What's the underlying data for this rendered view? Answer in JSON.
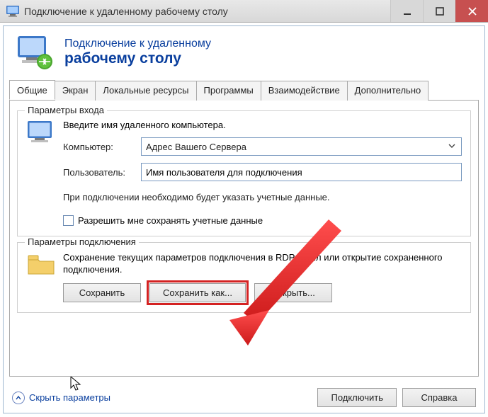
{
  "window": {
    "title": "Подключение к удаленному рабочему столу"
  },
  "header": {
    "subtitle": "Подключение к удаленному",
    "title": "рабочему столу"
  },
  "tabs": [
    {
      "label": "Общие"
    },
    {
      "label": "Экран"
    },
    {
      "label": "Локальные ресурсы"
    },
    {
      "label": "Программы"
    },
    {
      "label": "Взаимодействие"
    },
    {
      "label": "Дополнительно"
    }
  ],
  "login_group": {
    "legend": "Параметры входа",
    "intro": "Введите имя удаленного компьютера.",
    "computer_label": "Компьютер:",
    "computer_value": "Адрес Вашего Сервера",
    "user_label": "Пользователь:",
    "user_value": "Имя пользователя для подключения",
    "note": "При подключении необходимо будет указать учетные данные.",
    "checkbox_label": "Разрешить мне сохранять учетные данные"
  },
  "conn_group": {
    "legend": "Параметры подключения",
    "note": "Сохранение текущих параметров подключения в RDP-файл или открытие сохраненного подключения.",
    "save": "Сохранить",
    "save_as": "Сохранить как...",
    "open": "Открыть..."
  },
  "footer": {
    "collapse": "Скрыть параметры",
    "connect": "Подключить",
    "help": "Справка"
  }
}
